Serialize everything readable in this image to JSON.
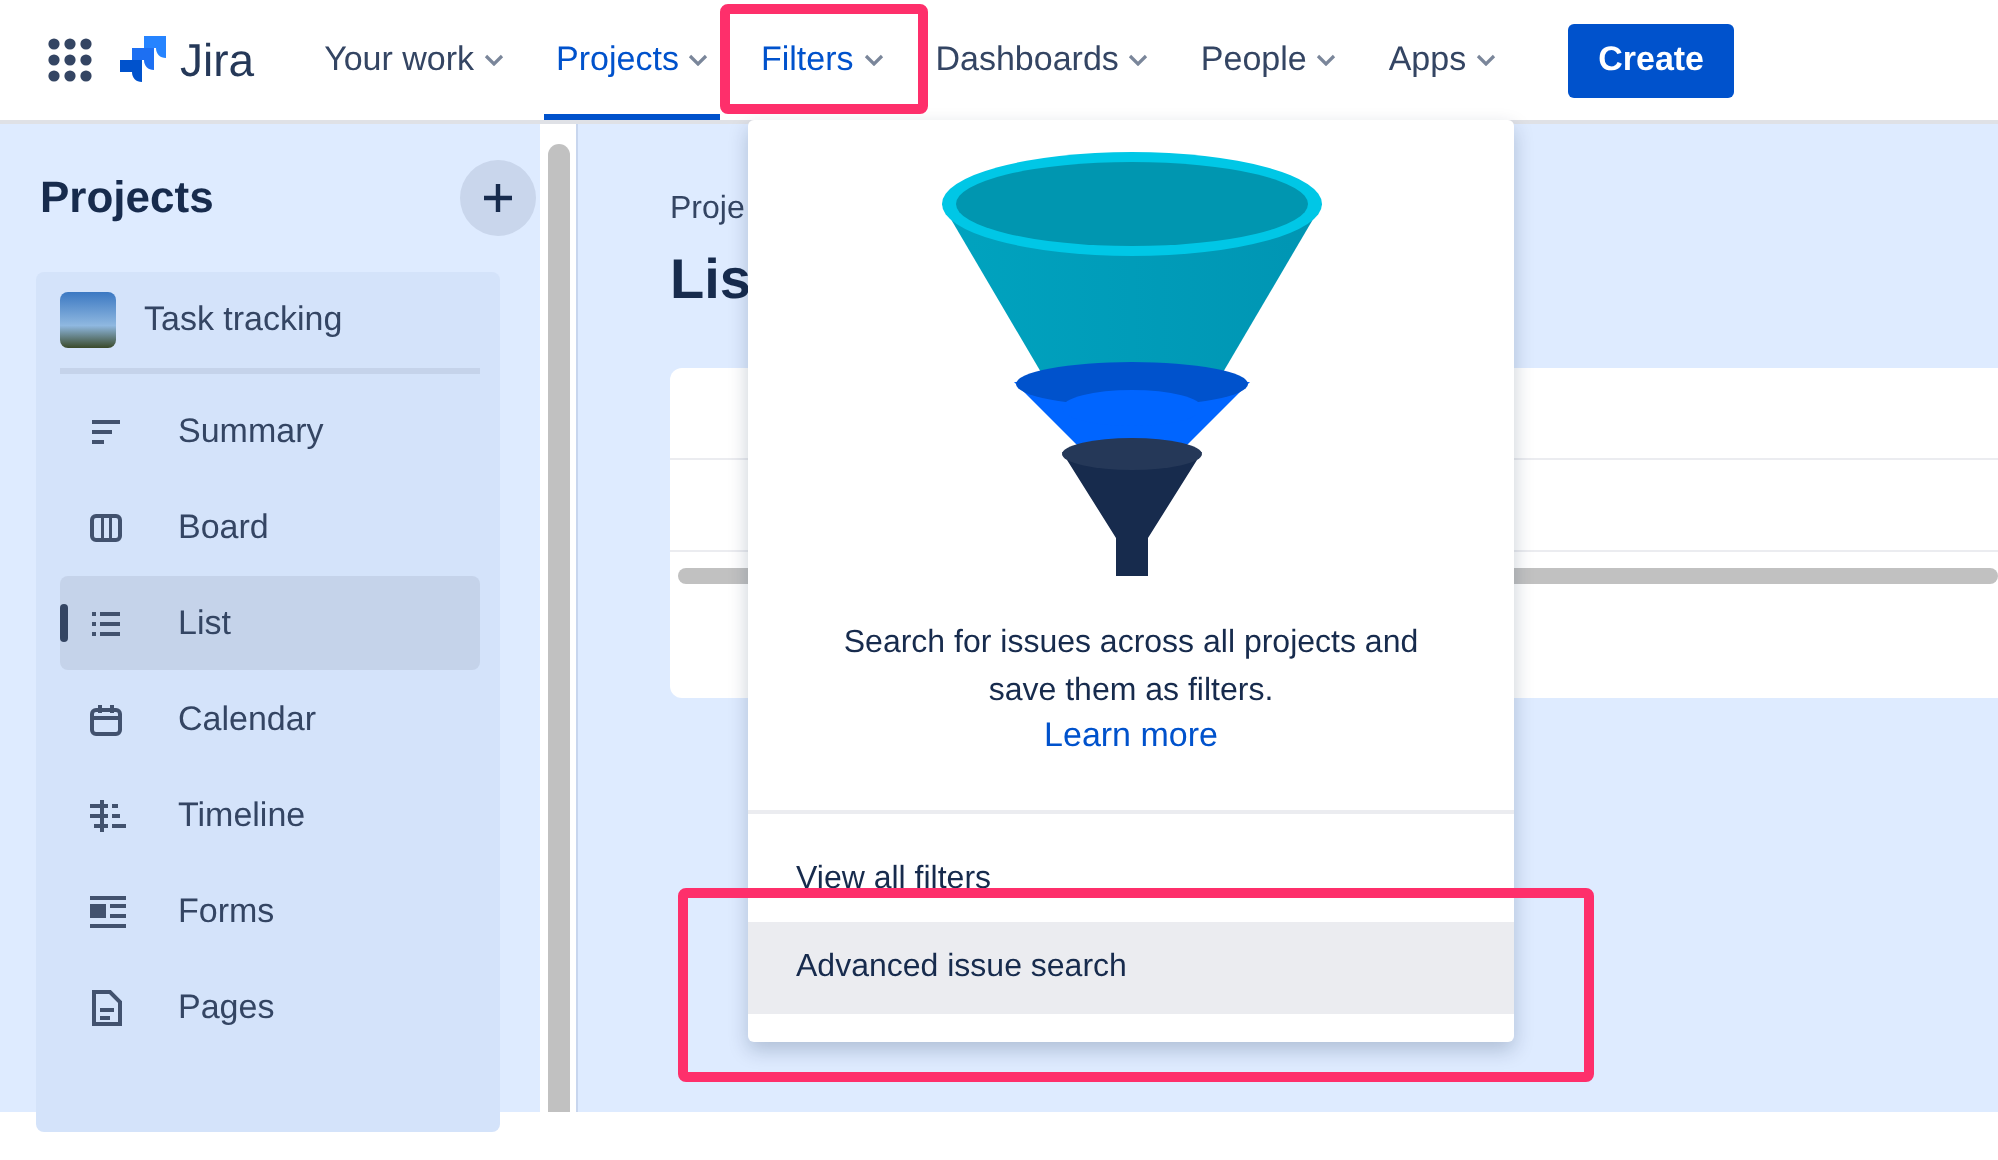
{
  "nav": {
    "logo": "Jira",
    "items": [
      {
        "label": "Your work",
        "selected": false
      },
      {
        "label": "Projects",
        "selected": true
      },
      {
        "label": "Filters",
        "selected": false
      },
      {
        "label": "Dashboards",
        "selected": false
      },
      {
        "label": "People",
        "selected": false
      },
      {
        "label": "Apps",
        "selected": false
      }
    ],
    "create": "Create"
  },
  "sidebar": {
    "title": "Projects",
    "project": "Task tracking",
    "items": [
      {
        "label": "Summary",
        "kind": "summary",
        "selected": false
      },
      {
        "label": "Board",
        "kind": "board",
        "selected": false
      },
      {
        "label": "List",
        "kind": "list",
        "selected": true
      },
      {
        "label": "Calendar",
        "kind": "calendar",
        "selected": false
      },
      {
        "label": "Timeline",
        "kind": "timeline",
        "selected": false
      },
      {
        "label": "Forms",
        "kind": "forms",
        "selected": false
      },
      {
        "label": "Pages",
        "kind": "pages",
        "selected": false
      }
    ]
  },
  "main": {
    "breadcrumb": "Proje",
    "title": "Lis"
  },
  "dropdown": {
    "description": "Search for issues across all projects and save them as filters.",
    "link": "Learn more",
    "items": [
      {
        "label": "View all filters",
        "selected": false
      },
      {
        "label": "Advanced issue search",
        "selected": true
      }
    ]
  }
}
